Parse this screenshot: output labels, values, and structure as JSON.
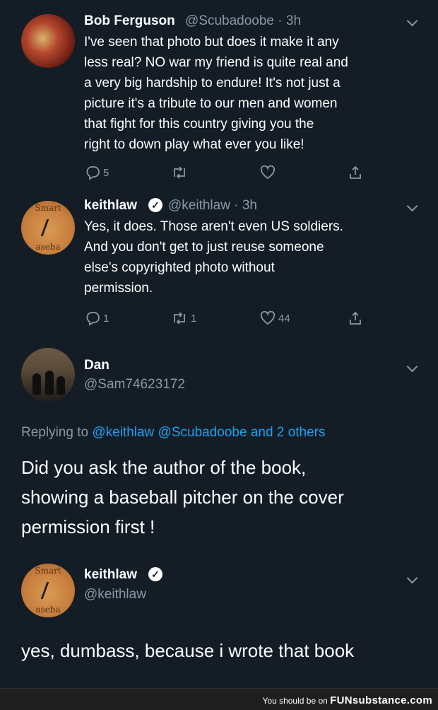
{
  "tweets": [
    {
      "name": "Bob Ferguson",
      "handle_time": "@Scubadoobe · 3h",
      "lines": [
        "I've seen that photo but does it make it any",
        "less real? NO war my friend is quite real and",
        "a very big hardship to endure! It's not just a",
        "picture it's a tribute to our men and women",
        "that fight for this country giving you the",
        "right to down play what ever you like!"
      ],
      "replies": "5",
      "retweets": "",
      "likes": ""
    },
    {
      "name": "keithlaw",
      "handle_time": "@keithlaw · 3h",
      "avatar_top": "Smart",
      "avatar_bottom": "aseba",
      "lines": [
        "Yes, it does. Those aren't even US soldiers.",
        "And you don't get to just reuse someone",
        "else's copyrighted photo without",
        "permission."
      ],
      "replies": "1",
      "retweets": "1",
      "likes": "44"
    }
  ],
  "dan": {
    "name": "Dan",
    "handle": "@Sam74623172",
    "replying_prefix": "Replying to",
    "replying_mentions": "@keithlaw @Scubadoobe and 2 others",
    "lines": [
      "Did you ask the author of the book,",
      "showing a baseball pitcher  on the cover",
      "permission first !"
    ]
  },
  "keith_reply": {
    "name": "keithlaw",
    "handle": "@keithlaw",
    "avatar_top": "Smart",
    "avatar_bottom": "aseba",
    "text": "yes, dumbass, because i wrote that book"
  },
  "footer": {
    "prefix": "You should be on",
    "brand": "FUNsubstance.com"
  }
}
